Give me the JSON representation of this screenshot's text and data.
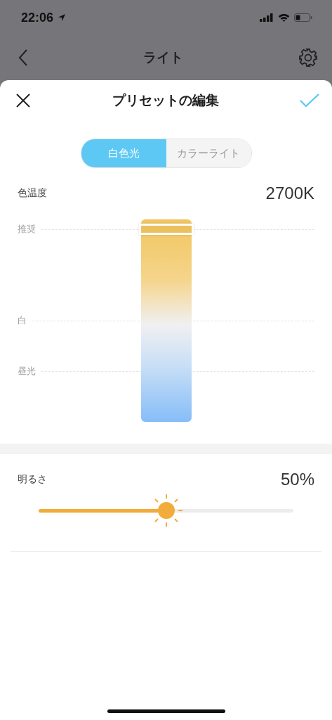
{
  "status_bar": {
    "time": "22:06"
  },
  "nav": {
    "title": "ライト"
  },
  "sheet": {
    "title": "プリセットの編集"
  },
  "modes": [
    {
      "label": "白色光",
      "selected": true
    },
    {
      "label": "カラーライト",
      "selected": false
    }
  ],
  "color_temperature": {
    "label": "色温度",
    "reading": "2700K",
    "level": 0.95,
    "markers": [
      {
        "label": "推奨"
      },
      {
        "label": "白"
      },
      {
        "label": "昼光"
      }
    ]
  },
  "brightness": {
    "label": "明るさ",
    "reading": "50%",
    "level": 0.5
  }
}
